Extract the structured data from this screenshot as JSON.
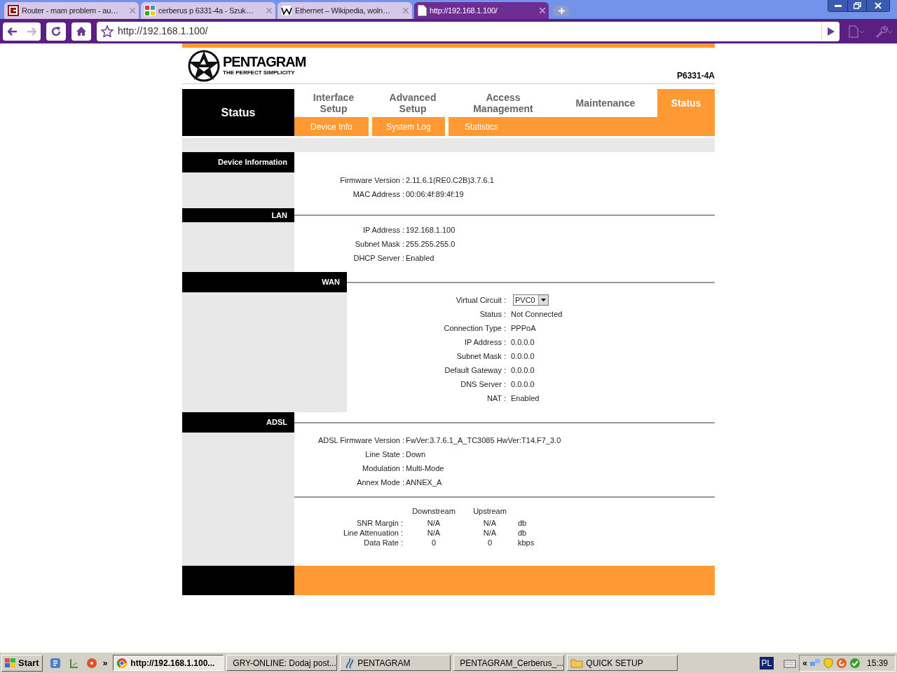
{
  "browser": {
    "tabs": [
      {
        "title": "Router - mam problem - au…",
        "selected": false
      },
      {
        "title": "cerberus p 6331-4a - Szuk…",
        "selected": false
      },
      {
        "title": "Ethernet – Wikipedia, woln…",
        "selected": false
      },
      {
        "title": "http://192.168.1.100/",
        "selected": true
      }
    ],
    "address": "http://192.168.1.100/"
  },
  "router": {
    "brand": "PENTAGRAM",
    "tagline": "THE PERFECT SIMPLICITY",
    "model": "P6331-4A",
    "side_title": "Status",
    "menu": [
      {
        "lines": [
          "Interface",
          "Setup"
        ],
        "selected": false
      },
      {
        "lines": [
          "Advanced",
          "Setup"
        ],
        "selected": false
      },
      {
        "lines": [
          "Access",
          "Management"
        ],
        "selected": false
      },
      {
        "lines": [
          "Maintenance"
        ],
        "selected": false
      },
      {
        "lines": [
          "Status"
        ],
        "selected": true
      }
    ],
    "submenu": [
      "Device Info",
      "System Log",
      "Statistics"
    ],
    "sections": [
      {
        "title": "Device Information",
        "rows": [
          {
            "kind": "text",
            "label": "Firmware Version :",
            "value": "2.11.6.1(RE0.C2B)3.7.6.1"
          },
          {
            "kind": "text",
            "label": "MAC Address :",
            "value": "00:06:4f:89:4f:19"
          }
        ]
      },
      {
        "title": "LAN",
        "rows": [
          {
            "kind": "text",
            "label": "IP Address :",
            "value": "192.168.1.100"
          },
          {
            "kind": "text",
            "label": "Subnet Mask :",
            "value": "255.255.255.0"
          },
          {
            "kind": "text",
            "label": "DHCP Server :",
            "value": "Enabled"
          }
        ]
      },
      {
        "title": "WAN",
        "rows": [
          {
            "kind": "select",
            "label": "Virtual Circuit :",
            "value": "PVC0"
          },
          {
            "kind": "text",
            "label": "Status :",
            "value": "Not Connected"
          },
          {
            "kind": "text",
            "label": "Connection Type :",
            "value": "PPPoA"
          },
          {
            "kind": "text",
            "label": "IP Address :",
            "value": "0.0.0.0"
          },
          {
            "kind": "text",
            "label": "Subnet Mask :",
            "value": "0.0.0.0"
          },
          {
            "kind": "text",
            "label": "Default Gateway :",
            "value": "0.0.0.0"
          },
          {
            "kind": "text",
            "label": "DNS Server :",
            "value": "0.0.0.0"
          },
          {
            "kind": "text",
            "label": "NAT :",
            "value": "Enabled"
          }
        ]
      },
      {
        "title": "ADSL",
        "rows": [
          {
            "kind": "text",
            "label": "ADSL Firmware Version :",
            "value": "FwVer:3.7.6.1_A_TC3085 HwVer:T14.F7_3.0"
          },
          {
            "kind": "text",
            "label": "Line State :",
            "value": "Down"
          },
          {
            "kind": "text",
            "label": "Modulation :",
            "value": "Multi-Mode"
          },
          {
            "kind": "text",
            "label": "Annex Mode :",
            "value": "ANNEX_A"
          }
        ],
        "stats": {
          "columns": [
            "Downstream",
            "Upstream"
          ],
          "rows": [
            {
              "label": "SNR Margin :",
              "downstream": "N/A",
              "upstream": "N/A",
              "unit": "db"
            },
            {
              "label": "Line Attenuation :",
              "downstream": "N/A",
              "upstream": "N/A",
              "unit": "db"
            },
            {
              "label": "Data Rate :",
              "downstream": "0",
              "upstream": "0",
              "unit": "kbps"
            }
          ]
        }
      }
    ]
  },
  "taskbar": {
    "start": "Start",
    "more": "»",
    "tasks": [
      {
        "label": "http://192.168.1.100...",
        "selected": true
      },
      {
        "label": "GRY-ONLINE: Dodaj post...",
        "selected": false
      },
      {
        "label": "PENTAGRAM",
        "selected": false
      },
      {
        "label": "PENTAGRAM_Cerberus_...",
        "selected": false
      },
      {
        "label": "QUICK SETUP",
        "selected": false
      }
    ],
    "language": "PL",
    "tray_more": "«",
    "clock": "15:39"
  }
}
